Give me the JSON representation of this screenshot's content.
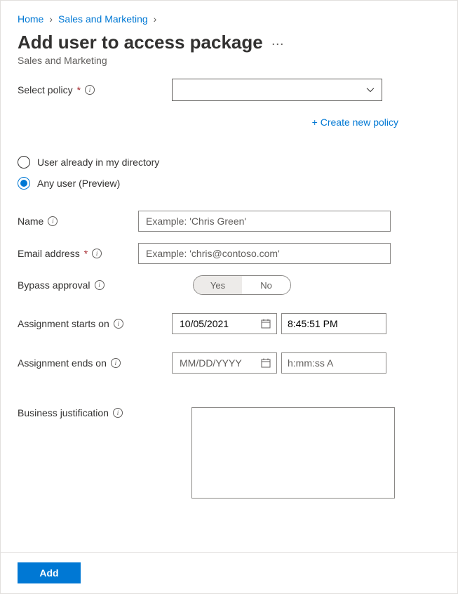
{
  "breadcrumb": {
    "home": "Home",
    "section": "Sales and Marketing"
  },
  "title": "Add user to access package",
  "subtitle": "Sales and Marketing",
  "policy": {
    "label": "Select policy",
    "create_link": "+ Create new policy"
  },
  "user_source": {
    "directory": "User already in my directory",
    "any": "Any user (Preview)",
    "selected": "any"
  },
  "fields": {
    "name": {
      "label": "Name",
      "placeholder": "Example: 'Chris Green'",
      "value": ""
    },
    "email": {
      "label": "Email address",
      "placeholder": "Example: 'chris@contoso.com'",
      "value": ""
    },
    "bypass": {
      "label": "Bypass approval",
      "yes": "Yes",
      "no": "No",
      "value": "yes"
    },
    "starts": {
      "label": "Assignment starts on",
      "date": "10/05/2021",
      "time": "8:45:51 PM"
    },
    "ends": {
      "label": "Assignment ends on",
      "date_placeholder": "MM/DD/YYYY",
      "time_placeholder": "h:mm:ss A"
    },
    "justification": {
      "label": "Business justification",
      "value": ""
    }
  },
  "actions": {
    "add": "Add"
  }
}
